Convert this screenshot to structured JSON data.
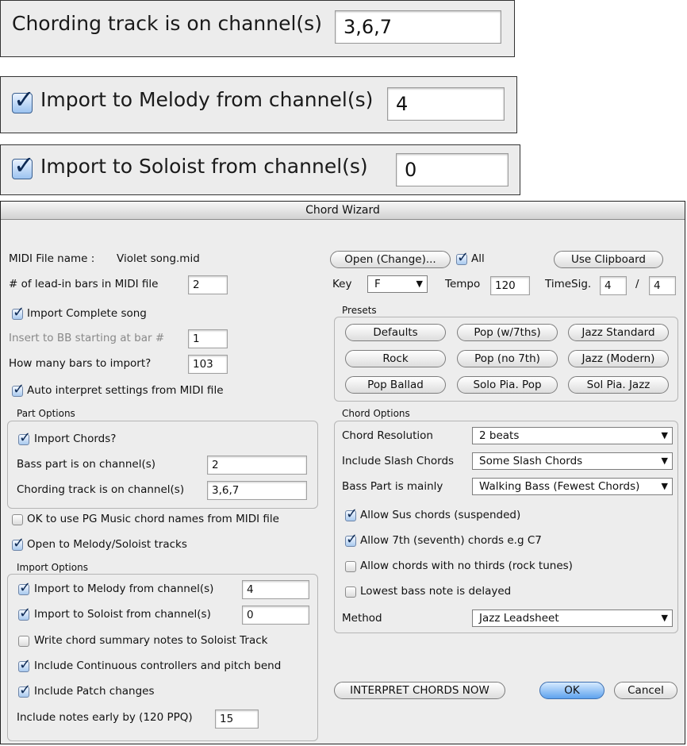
{
  "zoom": {
    "chording": {
      "label": "Chording track is on channel(s)",
      "value": "3,6,7"
    },
    "melody": {
      "label": "Import to Melody from channel(s)",
      "value": "4"
    },
    "soloist": {
      "label": "Import to Soloist from channel(s)",
      "value": "0"
    }
  },
  "dialog": {
    "title": "Chord Wizard",
    "midi_file_label": "MIDI File name :",
    "midi_file_name": "Violet song.mid",
    "leadin_label": "# of lead-in bars in MIDI file",
    "leadin_value": "2",
    "import_complete_label": "Import Complete song",
    "insert_label": "Insert to BB starting at bar #",
    "insert_value": "1",
    "howmany_label": "How many bars to import?",
    "howmany_value": "103",
    "auto_interpret_label": "Auto interpret settings from MIDI file",
    "part_options": {
      "title": "Part Options",
      "import_chords_label": "Import Chords?",
      "bass_label": "Bass part is on channel(s)",
      "bass_value": "2",
      "chording_label": "Chording track is on channel(s)",
      "chording_value": "3,6,7"
    },
    "ok_pg_label": "OK to use PG Music chord names from MIDI file",
    "open_melody_label": "Open to Melody/Soloist tracks",
    "import_options": {
      "title": "Import Options",
      "melody_label": "Import to Melody from channel(s)",
      "melody_value": "4",
      "soloist_label": "Import to Soloist from channel(s)",
      "soloist_value": "0",
      "write_summary_label": "Write chord summary notes to Soloist Track",
      "continuous_label": "Include Continuous controllers and pitch bend",
      "patch_label": "Include Patch changes",
      "early_label": "Include notes early by (120 PPQ)",
      "early_value": "15"
    },
    "open_change_button": "Open (Change)...",
    "all_label": "All",
    "use_clipboard_button": "Use Clipboard",
    "key_label": "Key",
    "key_value": "F",
    "tempo_label": "Tempo",
    "tempo_value": "120",
    "timesig_label": "TimeSig.",
    "timesig_num": "4",
    "timesig_sep": "/",
    "timesig_den": "4",
    "presets": {
      "title": "Presets",
      "buttons": [
        "Defaults",
        "Pop (w/7ths)",
        "Jazz Standard",
        "Rock",
        "Pop (no 7th)",
        "Jazz (Modern)",
        "Pop Ballad",
        "Solo Pia. Pop",
        "Sol Pia. Jazz"
      ]
    },
    "chord_options": {
      "title": "Chord Options",
      "resolution_label": "Chord Resolution",
      "resolution_value": "2 beats",
      "slash_label": "Include Slash Chords",
      "slash_value": "Some Slash Chords",
      "bass_mainly_label": "Bass Part is mainly",
      "bass_mainly_value": "Walking Bass (Fewest Chords)",
      "sus_label": "Allow Sus chords (suspended)",
      "seventh_label": "Allow 7th (seventh) chords e.g C7",
      "nothirds_label": "Allow chords with no thirds (rock tunes)",
      "lowest_label": "Lowest bass note is delayed",
      "method_label": "Method",
      "method_value": "Jazz Leadsheet"
    },
    "interpret_button": "INTERPRET CHORDS NOW",
    "ok_button": "OK",
    "cancel_button": "Cancel"
  }
}
